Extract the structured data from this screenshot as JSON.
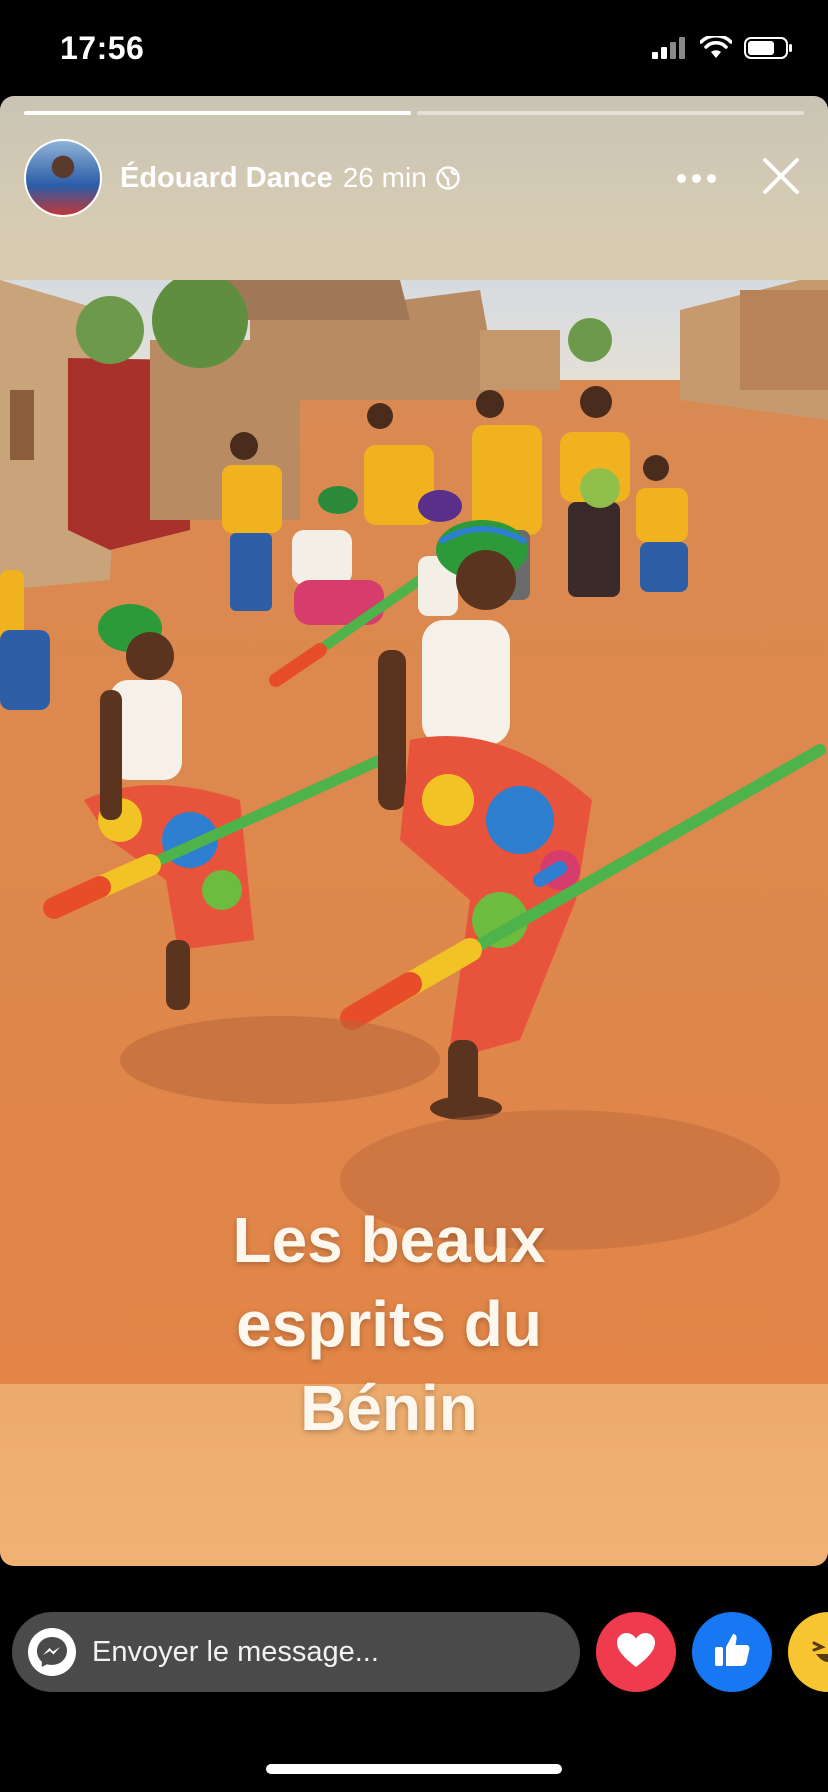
{
  "status_bar": {
    "time": "17:56"
  },
  "story": {
    "progress": [
      1.0,
      0.0
    ],
    "author": "Édouard Dance",
    "time_ago": "26 min",
    "caption_lines": [
      "Les beaux",
      "esprits du",
      "Bénin"
    ]
  },
  "reply": {
    "placeholder": "Envoyer le message..."
  },
  "reactions": [
    "love",
    "like",
    "haha"
  ],
  "colors": {
    "love": "#f03a4e",
    "like": "#1877f2",
    "haha": "#f7c531",
    "message_box": "#4a4a4a"
  }
}
